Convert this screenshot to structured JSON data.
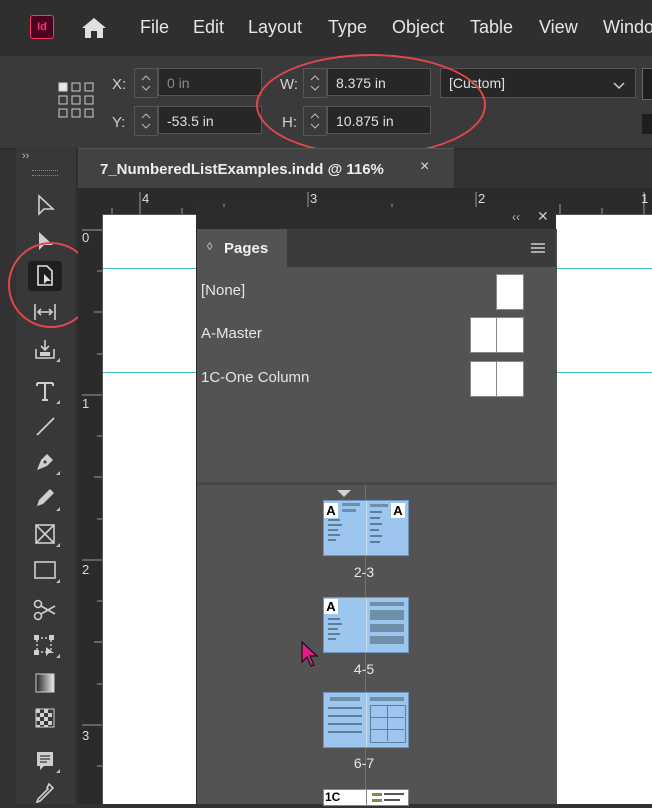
{
  "app": {
    "logo": "Id"
  },
  "menubar": {
    "items": [
      "File",
      "Edit",
      "Layout",
      "Type",
      "Object",
      "Table",
      "View",
      "Windo"
    ]
  },
  "control": {
    "x_label": "X:",
    "x_value": "0 in",
    "y_label": "Y:",
    "y_value": "-53.5 in",
    "w_label": "W:",
    "w_value": "8.375 in",
    "h_label": "H:",
    "h_value": "10.875 in",
    "preset": "[Custom]"
  },
  "document": {
    "tab_title": "7_NumberedListExamples.indd @ 116%",
    "close": "×"
  },
  "rulers": {
    "horizontal": [
      "4",
      "3",
      "2",
      "1"
    ],
    "vertical": [
      "0",
      "1",
      "2",
      "3"
    ]
  },
  "pages_panel": {
    "collapse": "‹‹",
    "close": "✕",
    "tab_icon": "◊",
    "tab_label": "Pages",
    "masters": [
      "[None]",
      "A-Master",
      "1C-One Column"
    ],
    "spreads": [
      "2-3",
      "4-5",
      "6-7"
    ],
    "master_marks": {
      "a": "A",
      "c": "1C"
    }
  },
  "tools": [
    "selection",
    "direct-selection",
    "page",
    "gap",
    "content-collector",
    "type",
    "line",
    "pen",
    "pencil",
    "rectangle-frame",
    "rectangle",
    "scissors",
    "free-transform",
    "gradient-swatch",
    "gradient-feather",
    "note",
    "eyedropper"
  ],
  "colors": {
    "annotation": "#e0474c",
    "guide": "#3cc4c4",
    "spread": "#9cc6ee",
    "cursor": "#e8198b"
  }
}
